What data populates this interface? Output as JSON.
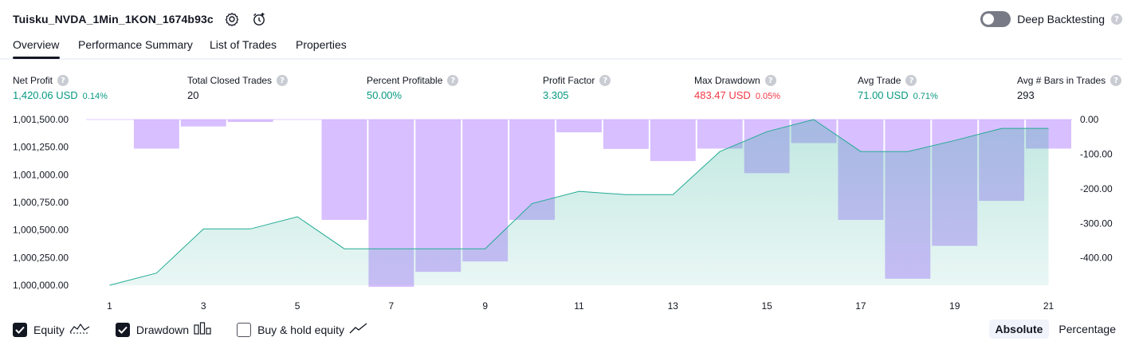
{
  "header": {
    "strategy_name": "Tuisku_NVDA_1Min_1KON_1674b93c",
    "deep_backtesting_label": "Deep Backtesting",
    "info_glyph": "?"
  },
  "tabs": [
    {
      "label": "Overview"
    },
    {
      "label": "Performance Summary"
    },
    {
      "label": "List of Trades"
    },
    {
      "label": "Properties"
    }
  ],
  "metrics": [
    {
      "label": "Net Profit",
      "value": "1,420.06 USD",
      "pct": "0.14%",
      "tone": "pos"
    },
    {
      "label": "Total Closed Trades",
      "value": "20",
      "pct": "",
      "tone": "plain"
    },
    {
      "label": "Percent Profitable",
      "value": "50.00%",
      "pct": "",
      "tone": "pos"
    },
    {
      "label": "Profit Factor",
      "value": "3.305",
      "pct": "",
      "tone": "pos"
    },
    {
      "label": "Max Drawdown",
      "value": "483.47 USD",
      "pct": "0.05%",
      "tone": "neg"
    },
    {
      "label": "Avg Trade",
      "value": "71.00 USD",
      "pct": "0.71%",
      "tone": "pos"
    },
    {
      "label": "Avg # Bars in Trades",
      "value": "293",
      "pct": "",
      "tone": "plain"
    }
  ],
  "colors": {
    "equity_line": "#22ab94",
    "equity_fill": "#22ab94",
    "drawdown_fill": "#c9a6ff",
    "positive": "#089981",
    "negative": "#f23645"
  },
  "chart_data": {
    "type": "area",
    "x": [
      1,
      2,
      3,
      4,
      5,
      6,
      7,
      8,
      9,
      10,
      11,
      12,
      13,
      14,
      15,
      16,
      17,
      18,
      19,
      20,
      21
    ],
    "x_ticks": [
      "1",
      "3",
      "5",
      "7",
      "9",
      "11",
      "13",
      "15",
      "17",
      "19",
      "21"
    ],
    "left_axis": {
      "ylim": [
        1000000,
        1001500
      ],
      "tick_values": [
        1000000,
        1000250,
        1000500,
        1000750,
        1001000,
        1001250,
        1001500
      ],
      "tick_labels": [
        "1,000,000.00",
        "1,000,250.00",
        "1,000,500.00",
        "1,000,750.00",
        "1,001,000.00",
        "1,001,250.00",
        "1,001,500.00"
      ]
    },
    "right_axis": {
      "ylim": [
        -483.47,
        0
      ],
      "tick_values": [
        0,
        -100,
        -200,
        -300,
        -400
      ],
      "tick_labels": [
        "0.00",
        "-100.00",
        "-200.00",
        "-300.00",
        "-400.00"
      ]
    },
    "series": [
      {
        "name": "Equity",
        "kind": "line-area",
        "axis": "left",
        "values": [
          1000000,
          1000110,
          1000510,
          1000510,
          1000620,
          1000330,
          1000330,
          1000330,
          1000330,
          1000740,
          1000850,
          1000820,
          1000820,
          1001210,
          1001390,
          1001500,
          1001210,
          1001210,
          1001310,
          1001420,
          1001420
        ]
      },
      {
        "name": "Drawdown",
        "kind": "bar",
        "axis": "right",
        "values": [
          0,
          -84,
          -20,
          -7,
          0,
          -290,
          -483.47,
          -440,
          -410,
          -290,
          -37,
          -85,
          -120,
          -84,
          -155,
          -68,
          -290,
          -460,
          -365,
          -235,
          -84
        ]
      }
    ]
  },
  "legend": [
    {
      "label": "Equity",
      "checked": true,
      "icon": "equity-line-icon"
    },
    {
      "label": "Drawdown",
      "checked": true,
      "icon": "drawdown-bars-icon"
    },
    {
      "label": "Buy & hold equity",
      "checked": false,
      "icon": "buy-hold-line-icon"
    }
  ],
  "scale_toggle": [
    {
      "label": "Absolute",
      "active": true
    },
    {
      "label": "Percentage",
      "active": false
    }
  ]
}
